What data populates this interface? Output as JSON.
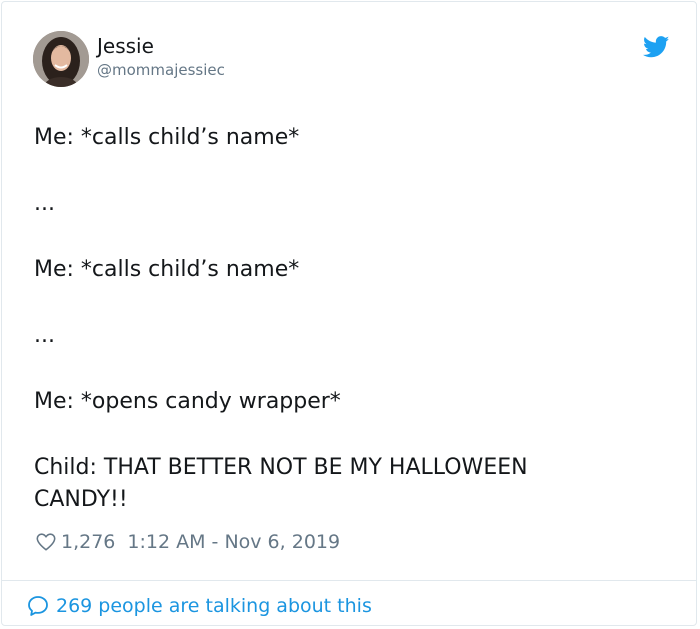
{
  "author": {
    "name": "Jessie",
    "handle": "@mommajessiec",
    "avatar_icon": "profile-photo"
  },
  "brand_icon": "twitter-bird-icon",
  "brand_color": "#1da1f2",
  "tweet_lines": [
    "Me: *calls child’s name*",
    "...",
    "Me: *calls child’s name*",
    "...",
    "Me: *opens candy wrapper*",
    "Child: THAT BETTER NOT BE MY HALLOWEEN",
    "CANDY!!"
  ],
  "likes": "1,276",
  "timestamp": "1:12 AM - Nov 6, 2019",
  "footer_text": "269 people are talking about this",
  "colors": {
    "text": "#14171a",
    "muted": "#657786",
    "link": "#1b95e0",
    "border": "#e1e8ed"
  }
}
